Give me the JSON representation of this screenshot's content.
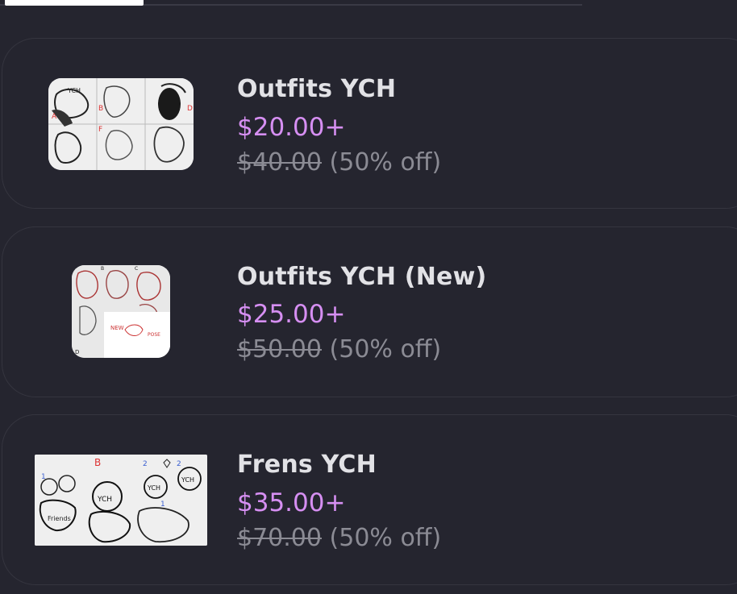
{
  "tabs": {
    "active_indicator": true
  },
  "products": [
    {
      "title": "Outfits YCH",
      "price": "$20.00+",
      "original_price": "$40.00",
      "discount": "(50% off)"
    },
    {
      "title": "Outfits YCH (New)",
      "price": "$25.00+",
      "original_price": "$50.00",
      "discount": "(50% off)"
    },
    {
      "title": "Frens YCH",
      "price": "$35.00+",
      "original_price": "$70.00",
      "discount": "(50% off)"
    }
  ],
  "colors": {
    "background": "#25252f",
    "title": "#e2e2e6",
    "price": "#d68ff2",
    "muted": "#8b8b94"
  }
}
